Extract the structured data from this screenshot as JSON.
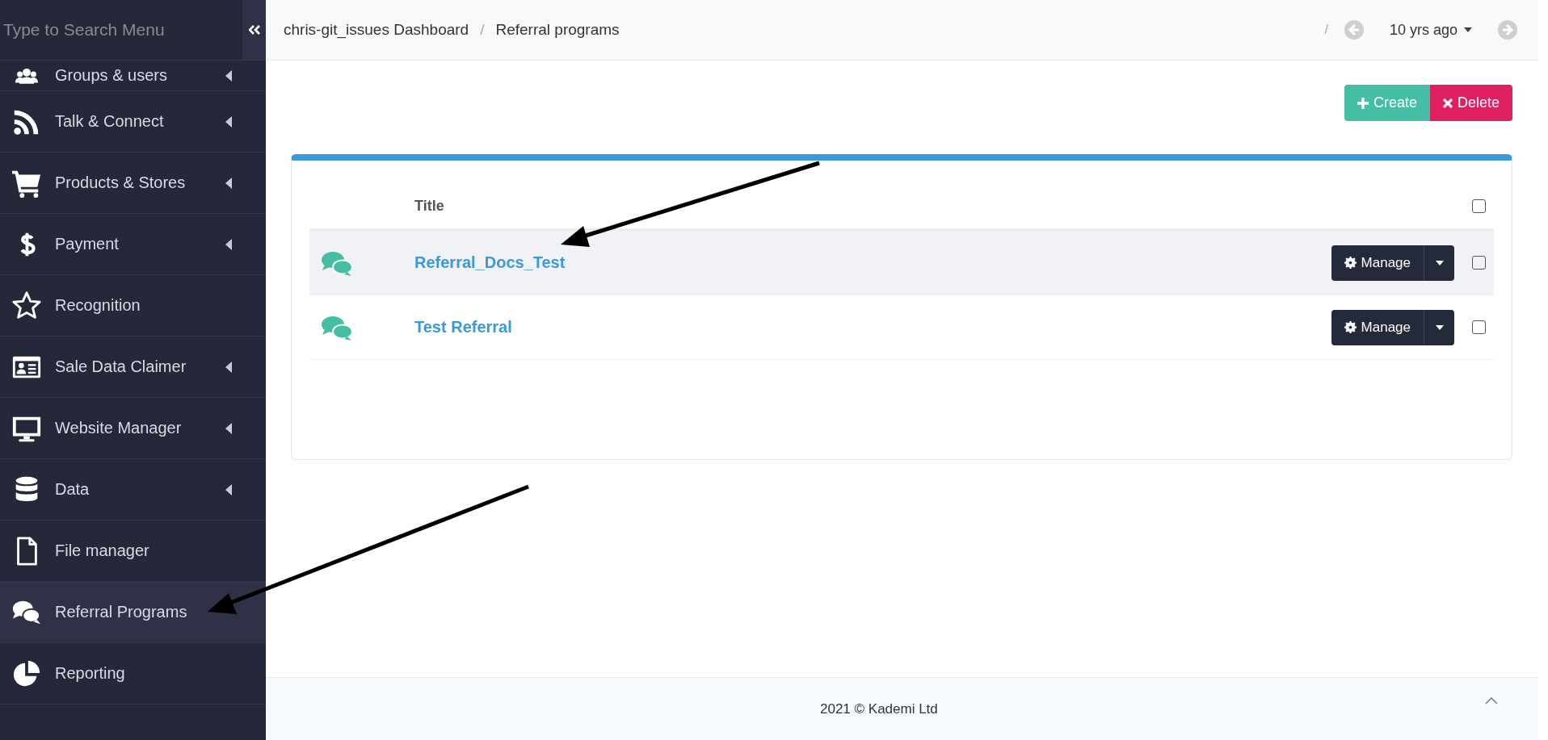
{
  "sidebar": {
    "search": {
      "placeholder": "Type to Search Menu"
    },
    "items": [
      {
        "label": "Groups & users",
        "submenu": true,
        "selected": false
      },
      {
        "label": "Talk & Connect",
        "submenu": true,
        "selected": false
      },
      {
        "label": "Products & Stores",
        "submenu": true,
        "selected": false
      },
      {
        "label": "Payment",
        "submenu": true,
        "selected": false
      },
      {
        "label": "Recognition",
        "submenu": false,
        "selected": false
      },
      {
        "label": "Sale Data Claimer",
        "submenu": true,
        "selected": false
      },
      {
        "label": "Website Manager",
        "submenu": true,
        "selected": false
      },
      {
        "label": "Data",
        "submenu": true,
        "selected": false
      },
      {
        "label": "File manager",
        "submenu": false,
        "selected": false
      },
      {
        "label": "Referral Programs",
        "submenu": false,
        "selected": true
      },
      {
        "label": "Reporting",
        "submenu": false,
        "selected": false
      }
    ]
  },
  "header": {
    "breadcrumb": [
      {
        "kind": "link",
        "text": "chris-git_issues Dashboard"
      },
      {
        "kind": "separator",
        "text": "/"
      },
      {
        "kind": "current",
        "text": "Referral programs"
      }
    ],
    "time_nav": {
      "separator": "/",
      "label": "10 yrs ago"
    }
  },
  "toolbar": [
    {
      "kind": "create",
      "label": "Create"
    },
    {
      "kind": "delete",
      "label": "Delete"
    }
  ],
  "table": {
    "columns": [
      {
        "label": "Title"
      }
    ],
    "select_all_checked": false,
    "rows": [
      {
        "title": "Referral_Docs_Test",
        "action": "Manage",
        "checked": false,
        "selected": true
      },
      {
        "title": "Test Referral",
        "action": "Manage",
        "checked": false,
        "selected": false
      }
    ]
  },
  "footer": {
    "text": "2021 © Kademi Ltd"
  }
}
